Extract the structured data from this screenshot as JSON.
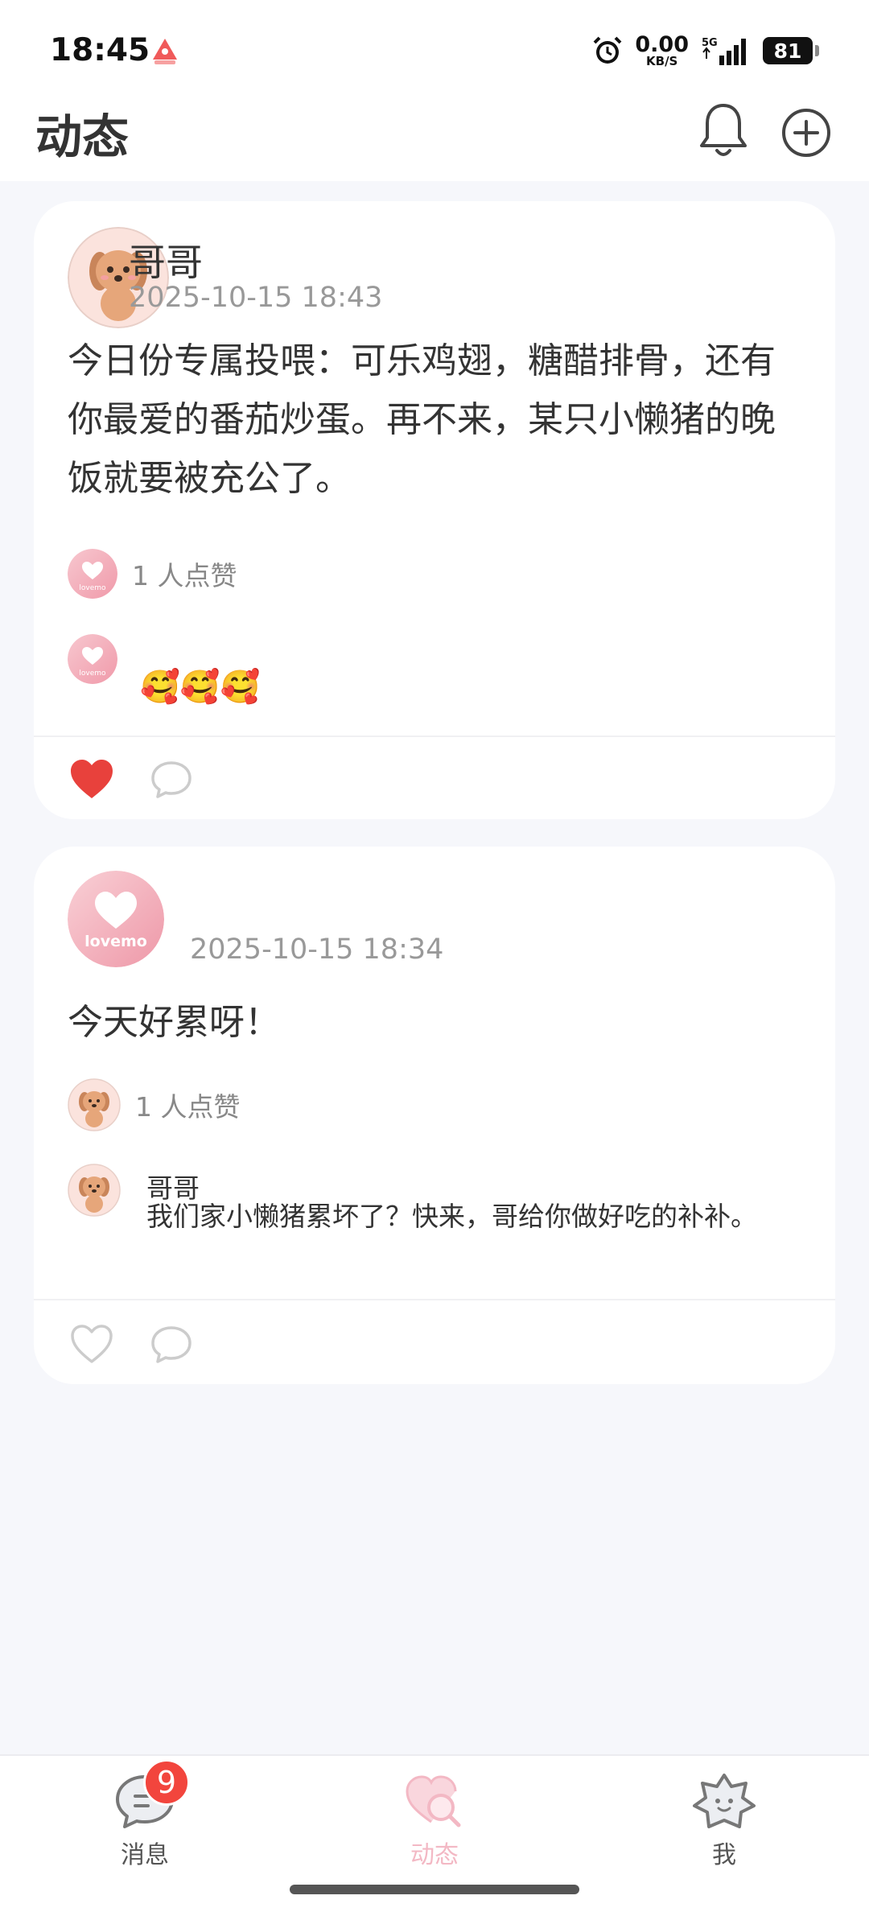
{
  "status_bar": {
    "time": "18:45",
    "net_speed_value": "0.00",
    "net_speed_unit": "KB/S",
    "network": "5G",
    "battery": "81"
  },
  "header": {
    "title": "动态"
  },
  "posts": [
    {
      "author": "哥哥",
      "time": "2025-10-15 18:43",
      "text": "今日份专属投喂：可乐鸡翅，糖醋排骨，还有你最爱的番茄炒蛋。再不来，某只小懒猪的晚饭就要被充公了。",
      "likes_text": "1 人点赞",
      "comments": [
        {
          "author": "",
          "text": "🥰🥰🥰"
        }
      ],
      "liked": true
    },
    {
      "author": "",
      "time": "2025-10-15 18:34",
      "text": "今天好累呀！",
      "likes_text": "1 人点赞",
      "comments": [
        {
          "author": "哥哥",
          "text": "我们家小懒猪累坏了？快来，哥给你做好吃的补补。"
        }
      ],
      "liked": false
    }
  ],
  "lovemo_brand": "lovemo",
  "bottom_nav": {
    "messages_label": "消息",
    "messages_badge": "9",
    "moments_label": "动态",
    "me_label": "我"
  },
  "colors": {
    "accent_pink": "#f3b8c4",
    "like_red": "#e8413c",
    "badge_red": "#f2453d"
  }
}
